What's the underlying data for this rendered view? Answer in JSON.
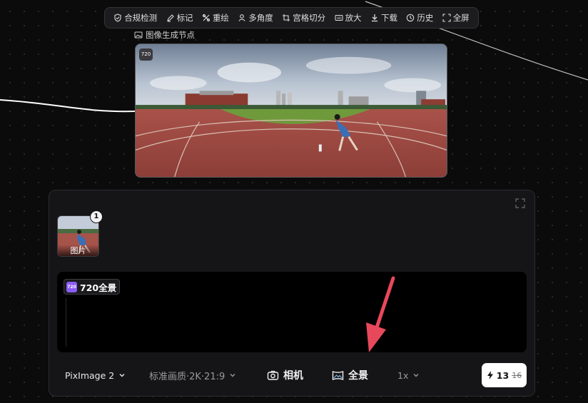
{
  "toolbar": {
    "items": [
      {
        "label": "合规检测",
        "icon": "shield-check-icon"
      },
      {
        "label": "标记",
        "icon": "pen-marker-icon"
      },
      {
        "label": "重绘",
        "icon": "repaint-icon"
      },
      {
        "label": "多角度",
        "icon": "multi-angle-icon"
      },
      {
        "label": "宫格切分",
        "icon": "crop-grid-icon"
      },
      {
        "label": "放大",
        "icon": "hd-upscale-icon"
      },
      {
        "label": "下载",
        "icon": "download-icon"
      },
      {
        "label": "历史",
        "icon": "history-clock-icon"
      },
      {
        "label": "全屏",
        "icon": "fullscreen-icon"
      }
    ]
  },
  "node": {
    "title": "图像生成节点",
    "badge": "720"
  },
  "panel": {
    "thumbnail": {
      "label": "图片",
      "count": "1"
    },
    "prompt_tag": {
      "icon_text": "720",
      "label": "720全景"
    },
    "controls": {
      "model": "PixImage 2",
      "quality": "标准画质·2K·21:9",
      "camera": "相机",
      "panorama": "全景",
      "multiplier": "1x"
    },
    "generate": {
      "cost": "13",
      "original_cost": "16"
    }
  },
  "colors": {
    "background": "#0b0b0c",
    "panel": "#151517",
    "arrow": "#e8485c",
    "accent_tag": "#8b5cf6"
  }
}
